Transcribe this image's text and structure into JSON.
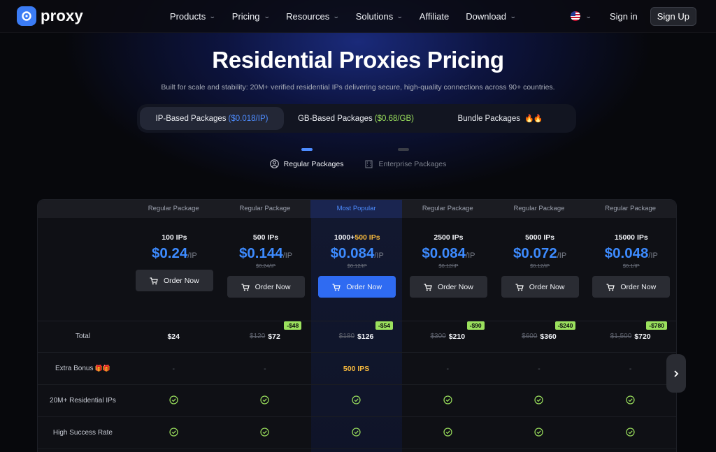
{
  "nav": {
    "logo_text": "proxy",
    "menu": [
      {
        "label": "Products",
        "dropdown": true
      },
      {
        "label": "Pricing",
        "dropdown": true
      },
      {
        "label": "Resources",
        "dropdown": true
      },
      {
        "label": "Solutions",
        "dropdown": true
      },
      {
        "label": "Affiliate",
        "dropdown": false
      },
      {
        "label": "Download",
        "dropdown": true
      }
    ],
    "signin": "Sign in",
    "signup": "Sign Up"
  },
  "hero": {
    "title": "Residential Proxies Pricing",
    "subtitle": "Built for scale and stability: 20M+ verified residential IPs delivering secure, high-quality connections across 90+ countries."
  },
  "package_tabs": [
    {
      "label": "IP-Based Packages",
      "price": "($0.018/IP)",
      "active": true
    },
    {
      "label": "GB-Based Packages",
      "price": "($0.68/GB)",
      "active": false
    },
    {
      "label": "Bundle Packages",
      "active": false
    }
  ],
  "sub_tabs": [
    {
      "label": "Regular Packages",
      "active": true
    },
    {
      "label": "Enterprise Packages",
      "active": false
    }
  ],
  "columns": [
    {
      "header": "Regular Package",
      "ips": "100 IPs",
      "ips_extra": "",
      "price": "$0.24",
      "unit": "/IP",
      "old": "",
      "order": "Order Now",
      "total_old": "",
      "total": "$24",
      "badge": "",
      "bonus": "-"
    },
    {
      "header": "Regular Package",
      "ips": "500 IPs",
      "ips_extra": "",
      "price": "$0.144",
      "unit": "/IP",
      "old": "$0.24/IP",
      "order": "Order Now",
      "total_old": "$120",
      "total": "$72",
      "badge": "-$48",
      "bonus": "-"
    },
    {
      "header": "Most Popular",
      "ips": "1000+",
      "ips_extra": "500 IPs",
      "price": "$0.084",
      "unit": "/IP",
      "old": "$0.12/IP",
      "order": "Order Now",
      "total_old": "$180",
      "total": "$126",
      "badge": "-$54",
      "bonus": "500 IPS"
    },
    {
      "header": "Regular Package",
      "ips": "2500 IPs",
      "ips_extra": "",
      "price": "$0.084",
      "unit": "/IP",
      "old": "$0.12/IP",
      "order": "Order Now",
      "total_old": "$300",
      "total": "$210",
      "badge": "-$90",
      "bonus": "-"
    },
    {
      "header": "Regular Package",
      "ips": "5000 IPs",
      "ips_extra": "",
      "price": "$0.072",
      "unit": "/IP",
      "old": "$0.12/IP",
      "order": "Order Now",
      "total_old": "$600",
      "total": "$360",
      "badge": "-$240",
      "bonus": "-"
    },
    {
      "header": "Regular Package",
      "ips": "15000 IPs",
      "ips_extra": "",
      "price": "$0.048",
      "unit": "/IP",
      "old": "$0.1/IP",
      "order": "Order Now",
      "total_old": "$1,500",
      "total": "$720",
      "badge": "-$780",
      "bonus": "-"
    }
  ],
  "row_labels": {
    "total": "Total",
    "bonus": "Extra Bonus",
    "residential": "20M+ Residential IPs",
    "success": "High Success Rate"
  },
  "colors": {
    "accent": "#3d8bff",
    "badge": "#9be15d",
    "highlight": "#f5b83d"
  }
}
